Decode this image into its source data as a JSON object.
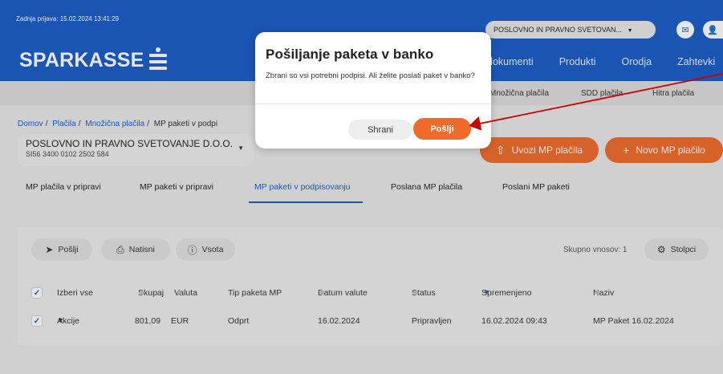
{
  "header": {
    "last_login": "Zadnja prijava: 15.02.2024 13:41:29",
    "logo_text": "SPARKASSE",
    "company_select": "POSLOVNO IN PRAVNO SVETOVAN...",
    "nav": [
      "dokumenti",
      "Produkti",
      "Orodja",
      "Zahtevki"
    ]
  },
  "subnav": [
    "Množična plačila",
    "SDD plačila",
    "Hitra plačila"
  ],
  "breadcrumb": {
    "home": "Domov",
    "payments": "Plačila",
    "bulk": "Množična plačila",
    "current": "MP paketi v podpi"
  },
  "account": {
    "name": "POSLOVNO IN PRAVNO SVETOVANJE D.O.O.",
    "iban": "SI56 3400 0102 2502 584"
  },
  "actions": {
    "import_label": "Uvozi MP plačila",
    "new_label": "Novo MP plačilo"
  },
  "tabs": [
    "MP plačila v pripravi",
    "MP paketi v pripravi",
    "MP paketi v podpisovanju",
    "Poslana MP plačila",
    "Poslani MP paketi"
  ],
  "toolbar": {
    "send": "Pošlji",
    "print": "Natisni",
    "sum": "Vsota",
    "total_count": "Skupno vnosov: 1",
    "columns": "Stolpci"
  },
  "table": {
    "headers": {
      "select_all": "Izberi vse",
      "total": "Skupaj",
      "currency": "Valuta",
      "package_type": "Tip paketa MP",
      "value_date": "Datum valute",
      "status": "Status",
      "modified": "Spremenjeno",
      "name": "Naziv"
    },
    "rows": [
      {
        "actions": "Akcije",
        "amount": "801,09",
        "currency": "EUR",
        "type": "Odprt",
        "value_date": "16.02.2024",
        "status": "Pripravljen",
        "modified": "16.02.2024 09:43",
        "name": "MP Paket 16.02.2024"
      }
    ]
  },
  "modal": {
    "title": "Pošiljanje paketa v banko",
    "message": "Zbrani so vsi potrebni podpisi. Ali želite poslati paket v banko?",
    "save_label": "Shrani",
    "send_label": "Pošlji"
  },
  "colors": {
    "brand_blue": "#1a5cc8",
    "accent_orange": "#f06a2a",
    "annotation_red": "#cc0000"
  }
}
